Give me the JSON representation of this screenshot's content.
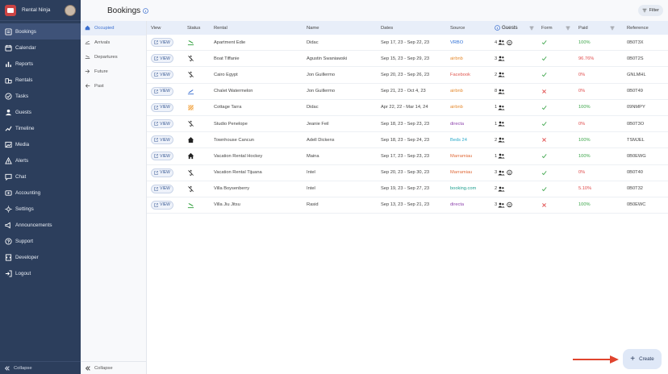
{
  "app": {
    "name": "Rental Ninja"
  },
  "nav": {
    "items": [
      {
        "label": "Bookings",
        "icon": "bookings-icon",
        "active": true
      },
      {
        "label": "Calendar",
        "icon": "calendar-icon"
      },
      {
        "label": "Reports",
        "icon": "reports-icon"
      },
      {
        "label": "Rentals",
        "icon": "rentals-icon"
      },
      {
        "label": "Tasks",
        "icon": "tasks-icon"
      },
      {
        "label": "Guests",
        "icon": "guests-icon"
      },
      {
        "label": "Timeline",
        "icon": "timeline-icon"
      },
      {
        "label": "Media",
        "icon": "media-icon"
      },
      {
        "label": "Alerts",
        "icon": "alerts-icon"
      },
      {
        "label": "Chat",
        "icon": "chat-icon"
      },
      {
        "label": "Accounting",
        "icon": "accounting-icon"
      },
      {
        "label": "Settings",
        "icon": "settings-icon"
      },
      {
        "label": "Announcements",
        "icon": "announcements-icon"
      },
      {
        "label": "Support",
        "icon": "support-icon"
      },
      {
        "label": "Developer",
        "icon": "developer-icon"
      },
      {
        "label": "Logout",
        "icon": "logout-icon"
      }
    ],
    "collapse_label": "Collapse"
  },
  "subnav": {
    "items": [
      {
        "label": "Occupied",
        "active": true
      },
      {
        "label": "Arrivals"
      },
      {
        "label": "Departures"
      },
      {
        "label": "Future"
      },
      {
        "label": "Past"
      }
    ],
    "collapse_label": "Collapse"
  },
  "header": {
    "title": "Bookings",
    "filter_label": "Filter"
  },
  "table": {
    "headers": {
      "view": "View",
      "status": "Status",
      "rental": "Rental",
      "name": "Name",
      "dates": "Dates",
      "source": "Source",
      "guests": "Guests",
      "form": "Form",
      "paid": "Paid",
      "reference": "Reference"
    },
    "rows": [
      {
        "status": "arrival",
        "rental": "Apartment Edie",
        "name": "Didac",
        "dates": "Sep 17, 23 - Sep 22, 23",
        "source": "VRBO",
        "source_color": "#2e6fd6",
        "guests": "4",
        "extra": true,
        "form": "ok",
        "paid": "100%",
        "paid_color": "#3ca54a",
        "ref": "0B0T3X"
      },
      {
        "status": "money",
        "rental": "Boat Tiffanie",
        "name": "Agustin Swaniawski",
        "dates": "Sep 15, 23 - Sep 29, 23",
        "source": "airbnb",
        "source_color": "#e58a2e",
        "guests": "3",
        "extra": false,
        "form": "ok",
        "paid": "96.76%",
        "paid_color": "#e04b4b",
        "ref": "0B0T2S"
      },
      {
        "status": "money",
        "rental": "Cairo Egypt",
        "name": "Jon Guillermo",
        "dates": "Sep 20, 23 - Sep 26, 23",
        "source": "Facebook",
        "source_color": "#e0564f",
        "guests": "2",
        "extra": false,
        "form": "ok",
        "paid": "0%",
        "paid_color": "#e04b4b",
        "ref": "GNLMHL"
      },
      {
        "status": "departure",
        "rental": "Chalet Watermelon",
        "name": "Jon Guillermo",
        "dates": "Sep 21, 23 - Oct 4, 23",
        "source": "airbnb",
        "source_color": "#e58a2e",
        "guests": "8",
        "extra": false,
        "form": "bad",
        "paid": "0%",
        "paid_color": "#e04b4b",
        "ref": "0B0T49"
      },
      {
        "status": "blocked",
        "rental": "Cottage Tarra",
        "name": "Didac",
        "dates": "Apr 22, 22 - Mar 14, 24",
        "source": "airbnb",
        "source_color": "#e58a2e",
        "guests": "1",
        "extra": false,
        "form": "ok",
        "paid": "100%",
        "paid_color": "#3ca54a",
        "ref": "09NMPY"
      },
      {
        "status": "money",
        "rental": "Studio Penelope",
        "name": "Jeanie Feil",
        "dates": "Sep 18, 23 - Sep 23, 23",
        "source": "directa",
        "source_color": "#8e44ad",
        "guests": "1",
        "extra": false,
        "form": "ok",
        "paid": "0%",
        "paid_color": "#e04b4b",
        "ref": "0B0T3O"
      },
      {
        "status": "home",
        "rental": "Townhouse Cancun",
        "name": "Adell Dickens",
        "dates": "Sep 18, 23 - Sep 24, 23",
        "source": "Beds 24",
        "source_color": "#2aa9c9",
        "guests": "2",
        "extra": false,
        "form": "bad",
        "paid": "100%",
        "paid_color": "#3ca54a",
        "ref": "TSMJEL"
      },
      {
        "status": "home-bold",
        "rental": "Vacation Rental Hockey",
        "name": "Maina",
        "dates": "Sep 17, 23 - Sep 23, 23",
        "source": "Marramiau",
        "source_color": "#e06b3a",
        "guests": "1",
        "extra": false,
        "form": "ok",
        "paid": "100%",
        "paid_color": "#3ca54a",
        "ref": "0B0EWG"
      },
      {
        "status": "money",
        "rental": "Vacation Rental Tijuana",
        "name": "Intel",
        "dates": "Sep 20, 23 - Sep 30, 23",
        "source": "Marramiau",
        "source_color": "#e06b3a",
        "guests": "3",
        "extra": true,
        "form": "ok",
        "paid": "0%",
        "paid_color": "#e04b4b",
        "ref": "0B0T40"
      },
      {
        "status": "money",
        "rental": "Villa Boysenberry",
        "name": "Intel",
        "dates": "Sep 19, 23 - Sep 27, 23",
        "source": "booking.com",
        "source_color": "#1f9f8f",
        "guests": "2",
        "extra": false,
        "form": "ok",
        "paid": "5.10%",
        "paid_color": "#e04b4b",
        "ref": "0B0T32"
      },
      {
        "status": "arrival",
        "rental": "Villa Jiu Jitsu",
        "name": "Rasid",
        "dates": "Sep 13, 23 - Sep 21, 23",
        "source": "directa",
        "source_color": "#8e44ad",
        "guests": "3",
        "extra": true,
        "form": "bad",
        "paid": "100%",
        "paid_color": "#3ca54a",
        "ref": "0B0EWC"
      }
    ],
    "view_label": "VIEW"
  },
  "create": {
    "label": "Create"
  },
  "colors": {
    "nav_bg": "#2c3e5c",
    "accent": "#3b6fd0",
    "ok": "#3ca54a",
    "bad": "#e04b4b",
    "arrow": "#e0442e"
  }
}
